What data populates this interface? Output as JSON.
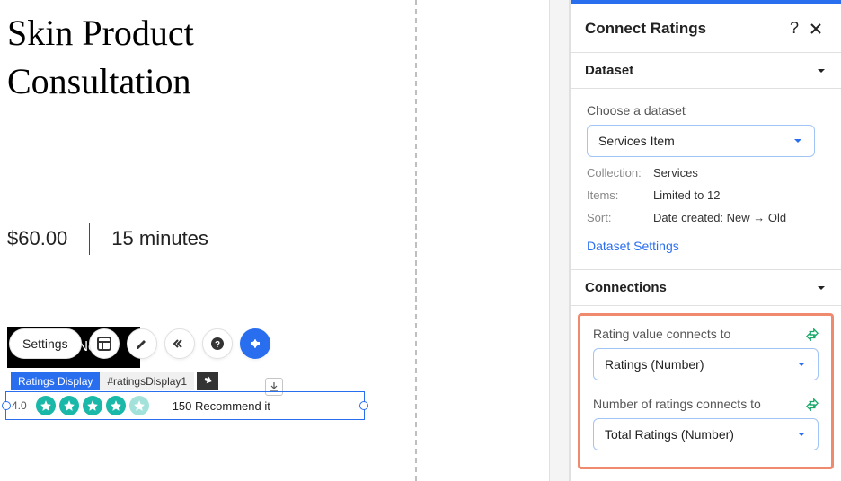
{
  "main": {
    "title_line1": "Skin Product",
    "title_line2": "Consultation",
    "price": "$60.00",
    "duration": "15 minutes",
    "book_label": "Book Now"
  },
  "toolbar": {
    "settings_label": "Settings"
  },
  "badges": {
    "component": "Ratings Display",
    "id": "#ratingsDisplay1"
  },
  "ratings": {
    "value": "4.0",
    "count": "150",
    "label": "Recommend it"
  },
  "panel": {
    "title": "Connect Ratings",
    "dataset_section": "Dataset",
    "choose_label": "Choose a dataset",
    "selected_dataset": "Services Item",
    "collection_label": "Collection:",
    "collection_value": "Services",
    "items_label": "Items:",
    "items_value": "Limited to 12",
    "sort_label": "Sort:",
    "sort_value": "Date created: New → Old",
    "dataset_settings": "Dataset Settings",
    "connections_section": "Connections",
    "rating_connects": "Rating value connects to",
    "rating_dropdown": "Ratings (Number)",
    "number_connects": "Number of ratings connects to",
    "number_dropdown": "Total Ratings (Number)"
  }
}
